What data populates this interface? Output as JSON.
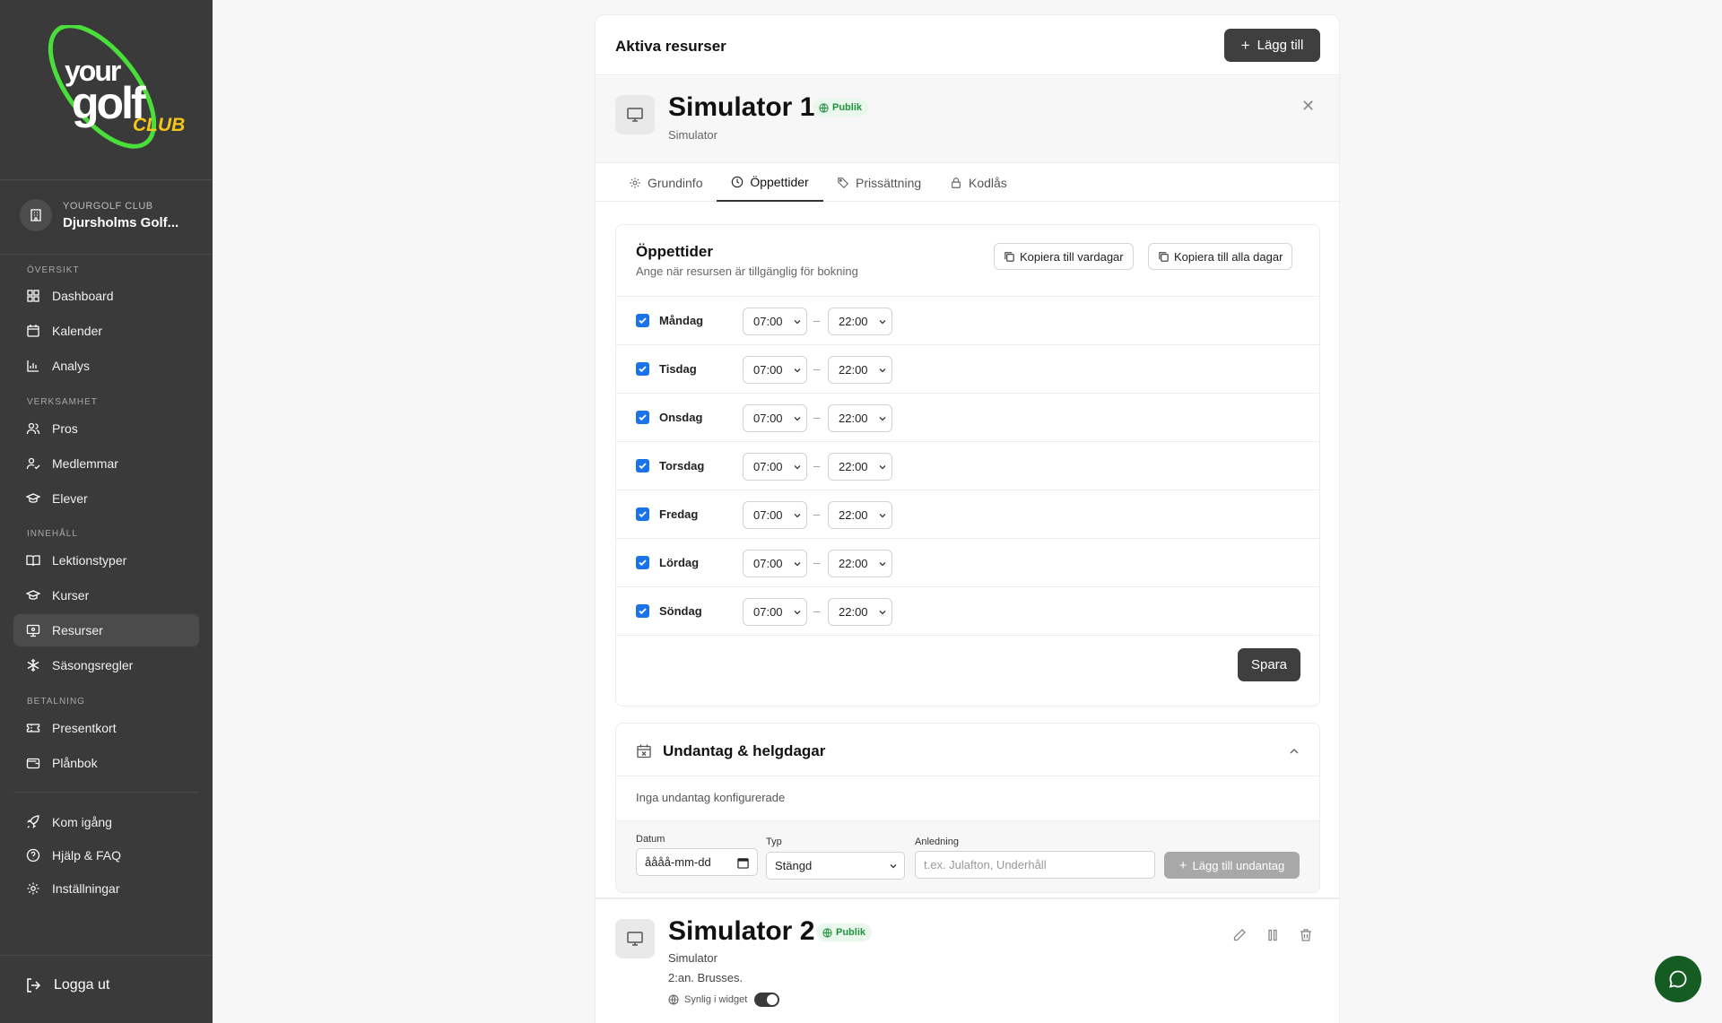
{
  "brand": {
    "logo_word1": "your",
    "logo_word2": "golf",
    "logo_word3": "CLUB",
    "accent": "#4ade3a",
    "accent2": "#f5c518"
  },
  "club": {
    "kicker": "YOURGOLF CLUB",
    "name": "Djursholms Golf..."
  },
  "sidebar": {
    "sections": [
      "ÖVERSIKT",
      "VERKSAMHET",
      "INNEHÅLL",
      "BETALNING"
    ],
    "items": [
      {
        "label": "Dashboard",
        "icon": "dashboard-icon"
      },
      {
        "label": "Kalender",
        "icon": "calendar-icon"
      },
      {
        "label": "Analys",
        "icon": "chart-icon"
      },
      {
        "label": "Pros",
        "icon": "users-icon"
      },
      {
        "label": "Medlemmar",
        "icon": "user-check-icon"
      },
      {
        "label": "Elever",
        "icon": "graduation-cap-icon"
      },
      {
        "label": "Lektionstyper",
        "icon": "book-icon"
      },
      {
        "label": "Kurser",
        "icon": "graduation-cap-icon"
      },
      {
        "label": "Resurser",
        "icon": "monitor-icon"
      },
      {
        "label": "Säsongsregler",
        "icon": "snowflake-icon"
      },
      {
        "label": "Presentkort",
        "icon": "ticket-icon"
      },
      {
        "label": "Plånbok",
        "icon": "wallet-icon"
      },
      {
        "label": "Kom igång",
        "icon": "rocket-icon"
      },
      {
        "label": "Hjälp & FAQ",
        "icon": "help-icon"
      },
      {
        "label": "Inställningar",
        "icon": "gear-icon"
      }
    ],
    "active": "Resurser",
    "logout": "Logga ut"
  },
  "main": {
    "title": "Aktiva resurser",
    "add_button": "Lägg till",
    "resource1": {
      "name": "Simulator 1",
      "badge": "Publik",
      "type": "Simulator",
      "tabs": [
        "Grundinfo",
        "Öppettider",
        "Prissättning",
        "Kodlås"
      ],
      "active_tab": "Öppettider"
    },
    "hours": {
      "title": "Öppettider",
      "subtitle": "Ange när resursen är tillgänglig för bokning",
      "copy_weekdays": "Kopiera till vardagar",
      "copy_all": "Kopiera till alla dagar",
      "days": [
        {
          "name": "Måndag",
          "open": "07:00",
          "close": "22:00",
          "enabled": true
        },
        {
          "name": "Tisdag",
          "open": "07:00",
          "close": "22:00",
          "enabled": true
        },
        {
          "name": "Onsdag",
          "open": "07:00",
          "close": "22:00",
          "enabled": true
        },
        {
          "name": "Torsdag",
          "open": "07:00",
          "close": "22:00",
          "enabled": true
        },
        {
          "name": "Fredag",
          "open": "07:00",
          "close": "22:00",
          "enabled": true
        },
        {
          "name": "Lördag",
          "open": "07:00",
          "close": "22:00",
          "enabled": true
        },
        {
          "name": "Söndag",
          "open": "07:00",
          "close": "22:00",
          "enabled": true
        }
      ],
      "separator": "–",
      "save": "Spara"
    },
    "exceptions": {
      "title": "Undantag & helgdagar",
      "empty": "Inga undantag konfigurerade",
      "date_label": "Datum",
      "date_placeholder": "åååå-mm-dd",
      "type_label": "Typ",
      "type_value": "Stängd",
      "reason_label": "Anledning",
      "reason_placeholder": "t.ex. Julafton, Underhåll",
      "add_button": "Lägg till undantag"
    },
    "resource2": {
      "name": "Simulator 2",
      "badge": "Publik",
      "type": "Simulator",
      "description": "2:an. Brusses.",
      "widget_label": "Synlig i widget",
      "widget_on": true
    }
  }
}
